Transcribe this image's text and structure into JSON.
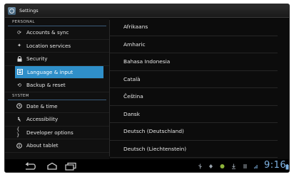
{
  "app": {
    "title": "Settings"
  },
  "sidebar": {
    "sections": [
      {
        "header": "PERSONAL"
      },
      {
        "header": "SYSTEM"
      }
    ],
    "items": [
      {
        "label": "Accounts & sync",
        "icon": "sync-icon"
      },
      {
        "label": "Location services",
        "icon": "location-icon"
      },
      {
        "label": "Security",
        "icon": "lock-icon"
      },
      {
        "label": "Language & input",
        "icon": "keyboard-icon",
        "selected": true
      },
      {
        "label": "Backup & reset",
        "icon": "backup-icon"
      },
      {
        "label": "Date & time",
        "icon": "clock-icon"
      },
      {
        "label": "Accessibility",
        "icon": "accessibility-icon"
      },
      {
        "label": "Developer options",
        "icon": "developer-icon"
      },
      {
        "label": "About tablet",
        "icon": "info-icon"
      }
    ]
  },
  "languages": [
    "Afrikaans",
    "Amharic",
    "Bahasa Indonesia",
    "Català",
    "Čeština",
    "Dansk",
    "Deutsch (Deutschland)",
    "Deutsch (Liechtenstein)"
  ],
  "status_bar": {
    "time": "9:16",
    "icons": [
      "usb-icon",
      "debug-icon",
      "notification-icon",
      "download-icon",
      "menu-icon",
      "signal-icon"
    ]
  },
  "colors": {
    "accent": "#2f8fc9",
    "time": "#7fb3e3",
    "background": "#0b0b0b"
  }
}
